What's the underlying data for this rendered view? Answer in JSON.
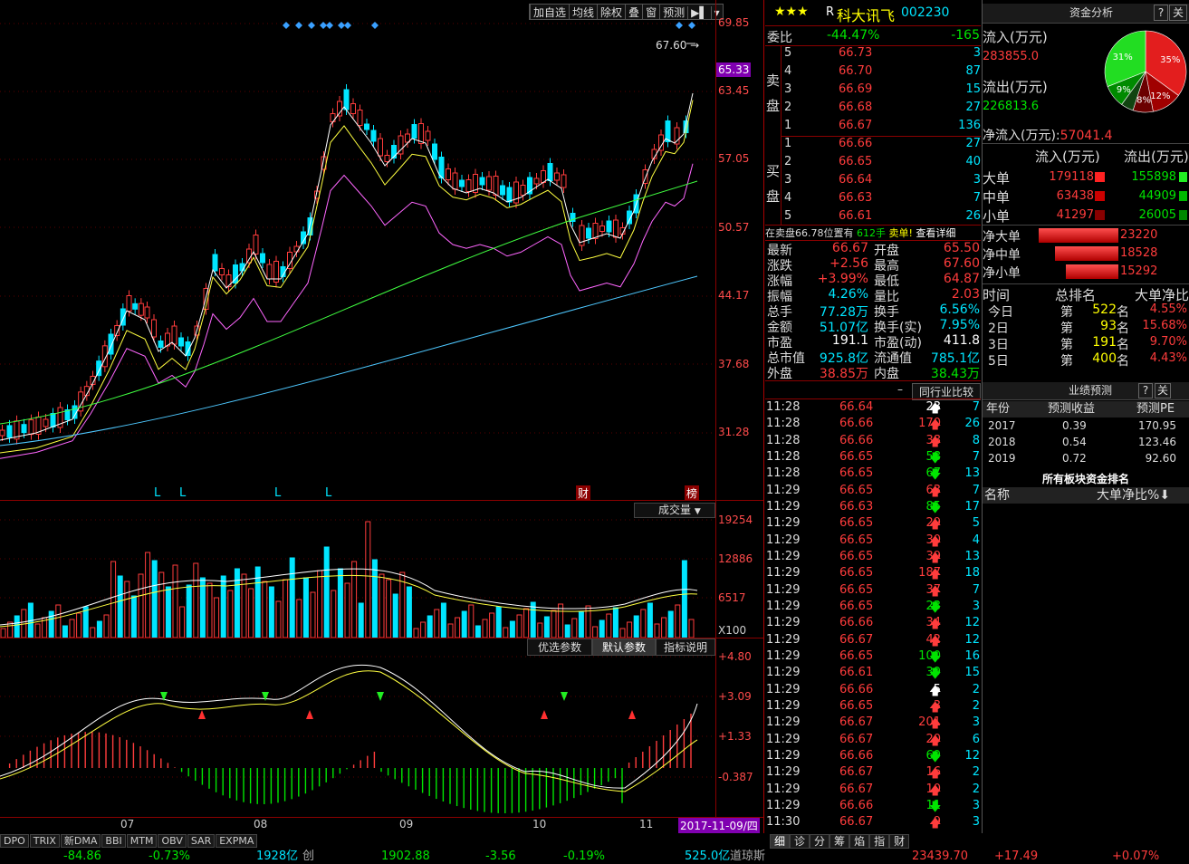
{
  "toolbar": {
    "buttons": [
      "加自选",
      "均线",
      "除权",
      "叠",
      "窗",
      "预测",
      "▶▌",
      "▾"
    ]
  },
  "price_axis": [
    "69.85",
    "63.45",
    "57.05",
    "50.57",
    "44.17",
    "37.68",
    "31.28"
  ],
  "current_price_tag": "65.33",
  "high_marker": "67.60",
  "chart_markers": {
    "L": [
      "L",
      "L",
      "L",
      "L"
    ],
    "cai": "财",
    "bang": "榜"
  },
  "volume_panel": {
    "label": "成交量",
    "axis": [
      "19254",
      "12886",
      "6517"
    ],
    "unit": "X100"
  },
  "macd_panel": {
    "buttons": [
      "优选参数",
      "默认参数",
      "指标说明"
    ],
    "axis": [
      "+4.80",
      "+3.09",
      "+1.33",
      "-0.387"
    ]
  },
  "time_axis": {
    "months": [
      "07",
      "08",
      "09",
      "10",
      "11"
    ],
    "date": "2017-11-09/四"
  },
  "bottom_tabs": [
    "DPO",
    "TRIX",
    "新DMA",
    "BBI",
    "MTM",
    "OBV",
    "SAR",
    "EXPMA"
  ],
  "status_bar": {
    "v1": "-84.86",
    "v2": "-0.73%",
    "v3": "1928亿",
    "v3b": "创",
    "v4": "1902.88",
    "v5": "-3.56",
    "v6": "-0.19%",
    "v7": "525.0亿",
    "v7b": "道琼斯",
    "v8": "23439.70",
    "v9": "+17.49",
    "v10": "+0.07%"
  },
  "stock": {
    "stars": "★★★",
    "prefix": "R",
    "name": "科大讯飞",
    "code": "002230"
  },
  "weibi": {
    "label": "委比",
    "pct": "-44.47%",
    "diff": "-165"
  },
  "sell_label": [
    "卖",
    "盘"
  ],
  "buy_label": [
    "买",
    "盘"
  ],
  "sell_orders": [
    {
      "level": "5",
      "price": "66.73",
      "vol": "3"
    },
    {
      "level": "4",
      "price": "66.70",
      "vol": "87"
    },
    {
      "level": "3",
      "price": "66.69",
      "vol": "15"
    },
    {
      "level": "2",
      "price": "66.68",
      "vol": "27"
    },
    {
      "level": "1",
      "price": "66.67",
      "vol": "136"
    }
  ],
  "buy_orders": [
    {
      "level": "1",
      "price": "66.66",
      "vol": "27"
    },
    {
      "level": "2",
      "price": "66.65",
      "vol": "40"
    },
    {
      "level": "3",
      "price": "66.64",
      "vol": "3"
    },
    {
      "level": "4",
      "price": "66.63",
      "vol": "7"
    },
    {
      "level": "5",
      "price": "66.61",
      "vol": "26"
    }
  ],
  "sell_notice": {
    "text": "在卖盘66.78位置有",
    "vol": "612手",
    "action": "卖单!",
    "link": "查看详细"
  },
  "stats": [
    {
      "l1": "最新",
      "v1": "66.67",
      "c1": "red",
      "l2": "开盘",
      "v2": "65.50",
      "c2": "red"
    },
    {
      "l1": "涨跌",
      "v1": "+2.56",
      "c1": "red",
      "l2": "最高",
      "v2": "67.60",
      "c2": "red"
    },
    {
      "l1": "涨幅",
      "v1": "+3.99%",
      "c1": "red",
      "l2": "最低",
      "v2": "64.87",
      "c2": "red"
    },
    {
      "l1": "振幅",
      "v1": "4.26%",
      "c1": "cyan",
      "l2": "量比",
      "v2": "2.03",
      "c2": "red"
    },
    {
      "l1": "总手",
      "v1": "77.28万",
      "c1": "cyan",
      "l2": "换手",
      "v2": "6.56%",
      "c2": "cyan"
    },
    {
      "l1": "金额",
      "v1": "51.07亿",
      "c1": "cyan",
      "l2": "换手(实)",
      "v2": "7.95%",
      "c2": "cyan"
    },
    {
      "l1": "市盈",
      "v1": "191.1",
      "c1": "white",
      "l2": "市盈(动)",
      "v2": "411.8",
      "c2": "white"
    },
    {
      "l1": "总市值",
      "v1": "925.8亿",
      "c1": "cyan",
      "l2": "流通值",
      "v2": "785.1亿",
      "c2": "cyan"
    },
    {
      "l1": "外盘",
      "v1": "38.85万",
      "c1": "red",
      "l2": "内盘",
      "v2": "38.43万",
      "c2": "green"
    }
  ],
  "compare": {
    "dash": "–",
    "label": "同行业比较"
  },
  "ticks": [
    {
      "t": "11:28",
      "p": "66.64",
      "v": "23",
      "d": "up",
      "c": "white",
      "n": "7"
    },
    {
      "t": "11:28",
      "p": "66.66",
      "v": "170",
      "d": "up",
      "c": "red",
      "n": "26"
    },
    {
      "t": "11:28",
      "p": "66.66",
      "v": "38",
      "d": "up",
      "c": "red",
      "n": "8"
    },
    {
      "t": "11:28",
      "p": "66.65",
      "v": "58",
      "d": "down",
      "c": "green",
      "n": "7"
    },
    {
      "t": "11:28",
      "p": "66.65",
      "v": "67",
      "d": "down",
      "c": "green",
      "n": "13"
    },
    {
      "t": "11:29",
      "p": "66.65",
      "v": "63",
      "d": "up",
      "c": "red",
      "n": "7"
    },
    {
      "t": "11:29",
      "p": "66.63",
      "v": "85",
      "d": "down",
      "c": "green",
      "n": "17"
    },
    {
      "t": "11:29",
      "p": "66.65",
      "v": "29",
      "d": "up",
      "c": "red",
      "n": "5"
    },
    {
      "t": "11:29",
      "p": "66.65",
      "v": "30",
      "d": "up",
      "c": "red",
      "n": "4"
    },
    {
      "t": "11:29",
      "p": "66.65",
      "v": "39",
      "d": "up",
      "c": "red",
      "n": "13"
    },
    {
      "t": "11:29",
      "p": "66.65",
      "v": "187",
      "d": "up",
      "c": "red",
      "n": "18"
    },
    {
      "t": "11:29",
      "p": "66.65",
      "v": "37",
      "d": "up",
      "c": "red",
      "n": "7"
    },
    {
      "t": "11:29",
      "p": "66.65",
      "v": "23",
      "d": "down",
      "c": "green",
      "n": "3"
    },
    {
      "t": "11:29",
      "p": "66.66",
      "v": "34",
      "d": "up",
      "c": "red",
      "n": "12"
    },
    {
      "t": "11:29",
      "p": "66.67",
      "v": "42",
      "d": "up",
      "c": "red",
      "n": "12"
    },
    {
      "t": "11:29",
      "p": "66.65",
      "v": "100",
      "d": "down",
      "c": "green",
      "n": "16"
    },
    {
      "t": "11:29",
      "p": "66.61",
      "v": "39",
      "d": "down",
      "c": "green",
      "n": "15"
    },
    {
      "t": "11:29",
      "p": "66.66",
      "v": "5",
      "d": "up",
      "c": "white",
      "n": "2"
    },
    {
      "t": "11:29",
      "p": "66.65",
      "v": "3",
      "d": "up",
      "c": "red",
      "n": "2"
    },
    {
      "t": "11:29",
      "p": "66.67",
      "v": "201",
      "d": "up",
      "c": "red",
      "n": "3"
    },
    {
      "t": "11:29",
      "p": "66.67",
      "v": "20",
      "d": "up",
      "c": "red",
      "n": "6"
    },
    {
      "t": "11:29",
      "p": "66.66",
      "v": "69",
      "d": "down",
      "c": "green",
      "n": "12"
    },
    {
      "t": "11:29",
      "p": "66.67",
      "v": "16",
      "d": "up",
      "c": "red",
      "n": "2"
    },
    {
      "t": "11:29",
      "p": "66.67",
      "v": "10",
      "d": "up",
      "c": "red",
      "n": "2"
    },
    {
      "t": "11:29",
      "p": "66.66",
      "v": "11",
      "d": "down",
      "c": "green",
      "n": "3"
    },
    {
      "t": "11:30",
      "p": "66.67",
      "v": "9",
      "d": "up",
      "c": "red",
      "n": "3"
    }
  ],
  "side_tabs": [
    "细",
    "诊",
    "分",
    "筹",
    "焰",
    "指",
    "财"
  ],
  "fund": {
    "title": "资金分析",
    "help": "?",
    "close": "关",
    "in_label": "流入(万元)",
    "in_value": "283855.0",
    "out_label": "流出(万元)",
    "out_value": "226813.6",
    "net_label": "净流入(万元):",
    "net_value": "57041.4",
    "pie": [
      {
        "label": "35%",
        "value": 35,
        "color": "#e31e1e"
      },
      {
        "label": "12%",
        "value": 12,
        "color": "#a00000"
      },
      {
        "label": "8%",
        "value": 8,
        "color": "#6b0000"
      },
      {
        "label": "9%",
        "value": 9,
        "color": "#008a00"
      },
      {
        "label": "31%",
        "value": 31,
        "color": "#22dd22"
      }
    ],
    "pie_other": {
      "value": 5,
      "color": "#114411"
    },
    "table_headers": [
      "流入(万元)",
      "流出(万元)"
    ],
    "rows": [
      {
        "name": "大单",
        "in": "179118",
        "out": "155898"
      },
      {
        "name": "中单",
        "in": "63438",
        "out": "44909"
      },
      {
        "name": "小单",
        "in": "41297",
        "out": "26005"
      }
    ],
    "net_rows": [
      {
        "name": "净大单",
        "value": "23220",
        "frac": 1.0
      },
      {
        "name": "净中单",
        "value": "18528",
        "frac": 0.8
      },
      {
        "name": "净小单",
        "value": "15292",
        "frac": 0.66
      }
    ],
    "rank_headers": [
      "时间",
      "总排名",
      "大单净比"
    ],
    "ranks": [
      {
        "day": "今日",
        "prefix": "第",
        "rank": "522",
        "suffix": "名",
        "pct": "4.55%"
      },
      {
        "day": "2日",
        "prefix": "第",
        "rank": "93",
        "suffix": "名",
        "pct": "15.68%"
      },
      {
        "day": "3日",
        "prefix": "第",
        "rank": "191",
        "suffix": "名",
        "pct": "9.70%"
      },
      {
        "day": "5日",
        "prefix": "第",
        "rank": "400",
        "suffix": "名",
        "pct": "4.43%"
      }
    ]
  },
  "forecast": {
    "title": "业绩预测",
    "help": "?",
    "close": "关",
    "headers": [
      "年份",
      "预测收益",
      "预测PE"
    ],
    "rows": [
      {
        "year": "2017",
        "eps": "0.39",
        "pe": "170.95"
      },
      {
        "year": "2018",
        "eps": "0.54",
        "pe": "123.46"
      },
      {
        "year": "2019",
        "eps": "0.72",
        "pe": "92.60"
      }
    ]
  },
  "sector": {
    "title": "所有板块资金排名",
    "col1": "名称",
    "col2": "大单净比%",
    "arrow": "⬇"
  }
}
